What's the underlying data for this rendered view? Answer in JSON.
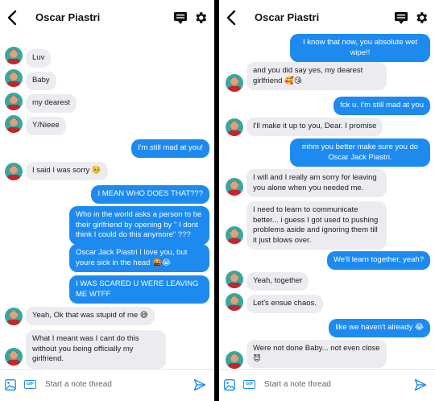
{
  "contact_name": "Oscar Piastri",
  "composer_placeholder": "Start a note thread",
  "gif_label": "GIF",
  "left_messages": [
    {
      "side": "in",
      "text": "Luv"
    },
    {
      "side": "in",
      "text": "Baby"
    },
    {
      "side": "in",
      "text": "my dearest"
    },
    {
      "side": "in",
      "text": "Y/Nieee"
    },
    {
      "side": "out",
      "text": "I'm still mad at you!"
    },
    {
      "side": "in",
      "text": "I said I was sorry 🥺"
    },
    {
      "side": "out",
      "text": "I MEAN WHO DOES THAT???"
    },
    {
      "side": "out",
      "text": "Who in the world asks a person to be their girlfriend by opening by \" I dont think I could do this anymore\" ???"
    },
    {
      "side": "out",
      "text": "Oscar Jack Piastri I love you, but youre sick in the head 🤬😭"
    },
    {
      "side": "out",
      "text": "I WAS SCARED U WERE LEAVING ME WTFF"
    },
    {
      "side": "in",
      "text": "Yeah, Ok that was stupid of me 😅"
    },
    {
      "side": "in",
      "text": "What I meant was I cant do this without you being officially my girlfriend."
    }
  ],
  "right_messages": [
    {
      "side": "out",
      "text": "I know that now, you absolute wet wipe!!"
    },
    {
      "side": "in",
      "text": "and you did say yes, my dearest girlfriend 🥰😘"
    },
    {
      "side": "out",
      "text": "fck u. I'm still mad at you"
    },
    {
      "side": "in",
      "text": "I'll make it up to you, Dear. I promise"
    },
    {
      "side": "out",
      "text": "mhm you better make sure you do Oscar Jack Piastri."
    },
    {
      "side": "in",
      "text": "I will and I really am sorry for leaving you alone when you needed me."
    },
    {
      "side": "in",
      "text": "I need to learn to communicate better... i guess I got used to pushing problems aside and ignoring them till it just blows over."
    },
    {
      "side": "out",
      "text": "We'll learn together, yeah?"
    },
    {
      "side": "in",
      "text": "Yeah, together"
    },
    {
      "side": "in",
      "text": "Let's ensue chaos."
    },
    {
      "side": "out",
      "text": "like we haven't already 😂"
    },
    {
      "side": "in",
      "text": "Were not done Baby... not even close 😈"
    }
  ]
}
